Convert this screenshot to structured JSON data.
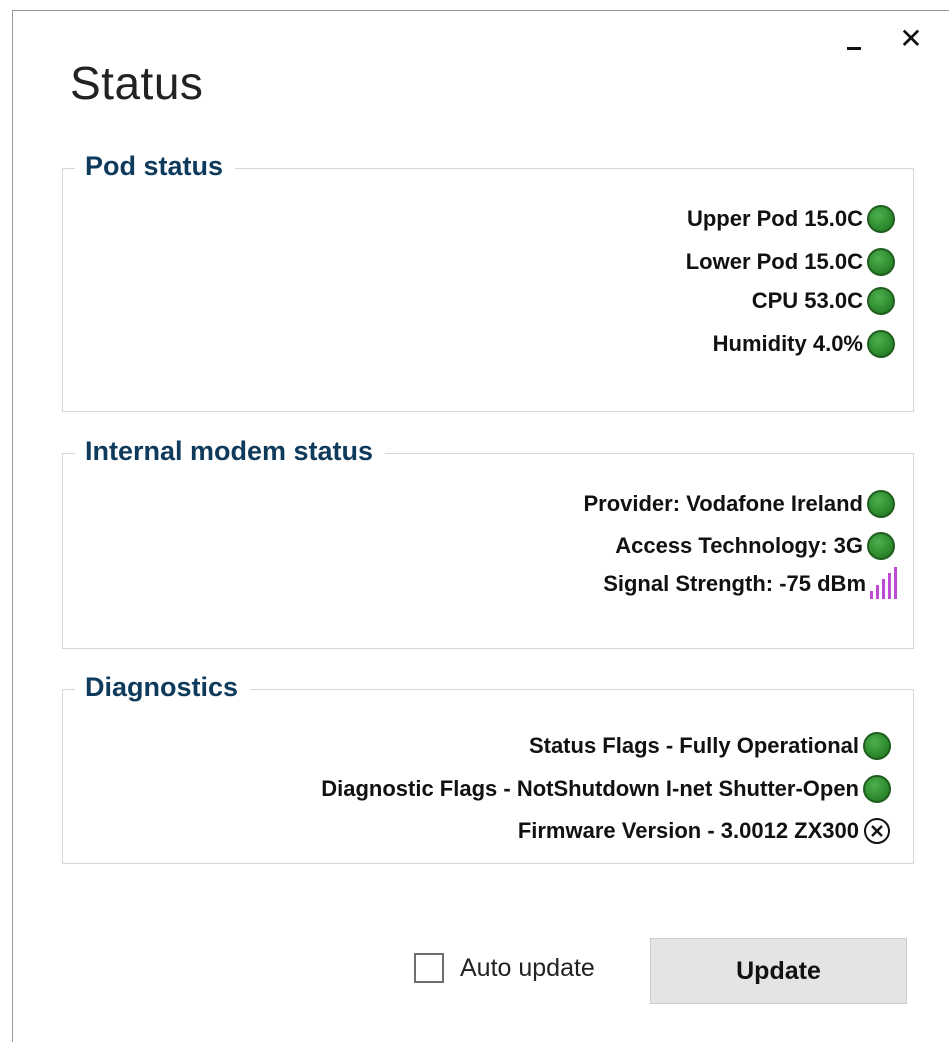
{
  "window": {
    "minimize_label": "Minimize",
    "close_glyph": "✕",
    "title": "Status"
  },
  "pod_status": {
    "title": "Pod status",
    "items": [
      {
        "label": "Upper Pod 15.0C",
        "indicator": "green-led-icon"
      },
      {
        "label": "Lower Pod 15.0C",
        "indicator": "green-led-icon"
      },
      {
        "label": "CPU 53.0C",
        "indicator": "green-led-icon"
      },
      {
        "label": "Humidity 4.0%",
        "indicator": "green-led-icon"
      }
    ]
  },
  "modem_status": {
    "title": "Internal modem status",
    "items": [
      {
        "label": "Provider: Vodafone Ireland",
        "indicator": "green-led-icon"
      },
      {
        "label": "Access Technology: 3G",
        "indicator": "green-led-icon"
      },
      {
        "label": "Signal Strength: -75 dBm",
        "indicator": "signal-bars-icon"
      }
    ]
  },
  "diagnostics": {
    "title": "Diagnostics",
    "items": [
      {
        "label": "Status Flags - Fully Operational",
        "indicator": "green-led-icon"
      },
      {
        "label": "Diagnostic Flags - NotShutdown I-net Shutter-Open",
        "indicator": "green-led-icon"
      },
      {
        "label": "Firmware Version - 3.0012 ZX300",
        "indicator": "circle-x-icon"
      }
    ]
  },
  "footer": {
    "auto_update_label": "Auto update",
    "auto_update_checked": false,
    "update_button_label": "Update"
  },
  "colors": {
    "led_green": "#2e8b2e",
    "group_title": "#0e3a5c",
    "signal_bars": "#c04ad6",
    "group_border": "#cfd7e0"
  }
}
